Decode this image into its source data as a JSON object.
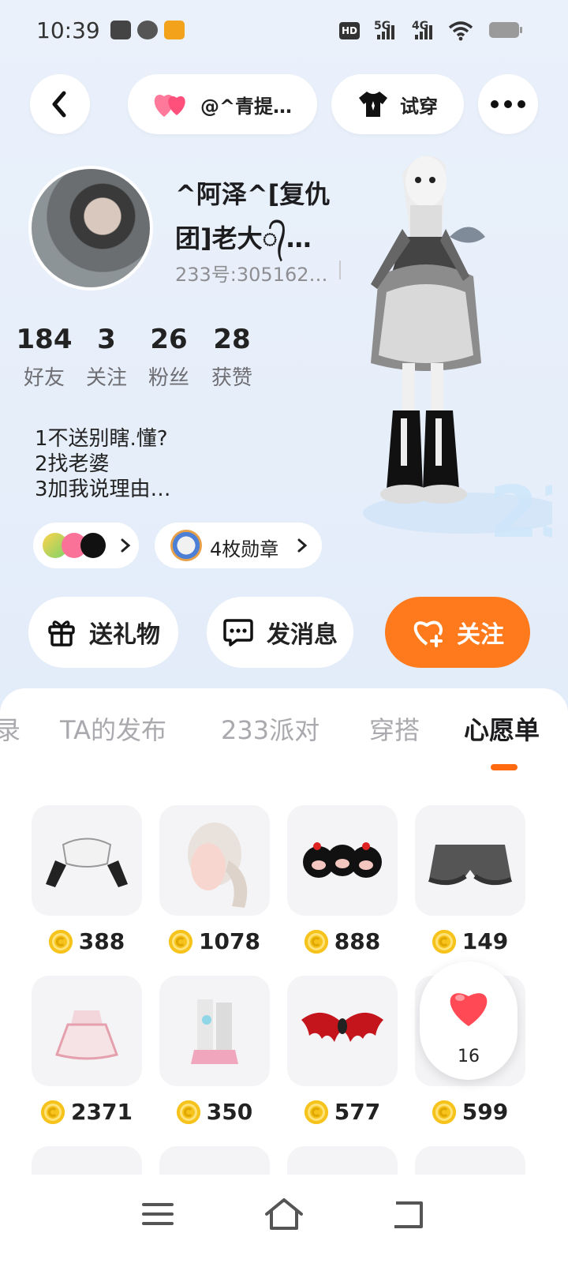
{
  "status_bar": {
    "time": "10:39",
    "hd_label": "HD",
    "net1": "5G",
    "net2": "4G"
  },
  "top_bar": {
    "back_icon": "chevron-left-icon",
    "user_pill_text": "@^青提…",
    "try_on_label": "试穿",
    "more_icon": "more-dots-icon"
  },
  "profile": {
    "name_line1": "^阿泽^[复仇",
    "name_line2": "团]老大᭄…",
    "uid": "233号:305162…",
    "stats": [
      {
        "num": "184",
        "label": "好友"
      },
      {
        "num": "3",
        "label": "关注"
      },
      {
        "num": "26",
        "label": "粉丝"
      },
      {
        "num": "28",
        "label": "获赞"
      }
    ],
    "bio_lines": [
      "1不送别瞎.懂?",
      "2找老婆",
      "3加我说理由…"
    ],
    "badge_chip_label": "4枚勋章"
  },
  "actions": {
    "gift_label": "送礼物",
    "message_label": "发消息",
    "follow_label": "关注"
  },
  "tabs": [
    {
      "label": "录",
      "active": false
    },
    {
      "label": "TA的发布",
      "active": false
    },
    {
      "label": "233派对",
      "active": false
    },
    {
      "label": "穿搭",
      "active": false
    },
    {
      "label": "心愿单",
      "active": true
    }
  ],
  "wishlist": [
    {
      "price": "388",
      "icon": "lace-gloves-icon"
    },
    {
      "price": "1078",
      "icon": "hair-bun-icon"
    },
    {
      "price": "888",
      "icon": "plush-trio-icon"
    },
    {
      "price": "149",
      "icon": "bloomers-icon"
    },
    {
      "price": "2371",
      "icon": "pink-dress-icon"
    },
    {
      "price": "350",
      "icon": "leg-warmers-icon"
    },
    {
      "price": "577",
      "icon": "bat-wings-icon"
    },
    {
      "price": "599",
      "icon": "hair-accessory-icon"
    }
  ],
  "like_bubble": {
    "count": "16"
  },
  "colors": {
    "accent": "#ff7a1c",
    "tab_indicator": "#ff6a10",
    "coin": "#f6c31c"
  }
}
